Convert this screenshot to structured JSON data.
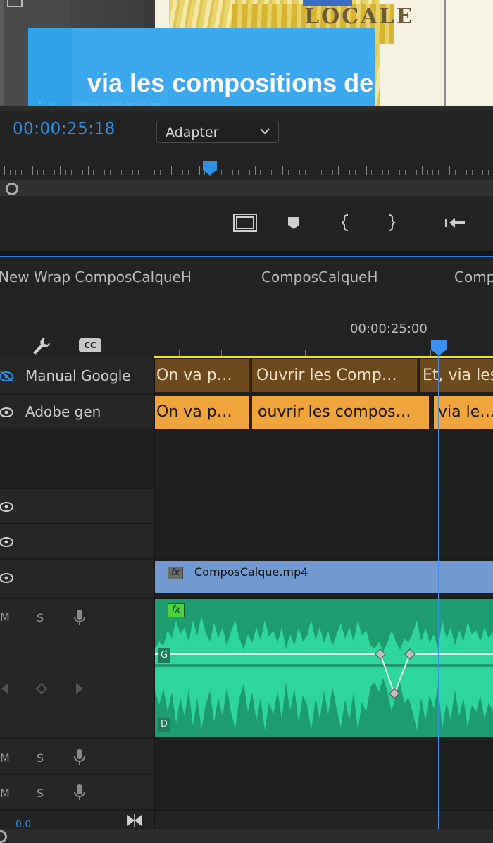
{
  "program_monitor": {
    "frame_text": "LOCALE",
    "caption_preview": "via les compositions de",
    "status_zoom": "50 %",
    "status_size": "2100 px × 2100 px (72 ppp)",
    "timecode": "00:00:25:18",
    "fit_select": "Adapter",
    "buttons": {
      "safe_margins": "safe-margins-icon",
      "add_marker": "marker-icon",
      "mark_in": "mark-in-icon",
      "mark_out": "mark-out-icon",
      "go_to_in": "go-to-in-icon"
    },
    "playhead_color": "#2f8fe0"
  },
  "timeline": {
    "sequence_tabs": [
      "New Wrap ComposCalqueH",
      "ComposCalqueH",
      "Compo"
    ],
    "timecode_label": "00:00:25:00",
    "header_icons": {
      "wrench": "wrench-icon",
      "captions": "CC"
    },
    "caption_tracks": [
      {
        "name": "Manual Google",
        "clips": [
          "On va p…",
          "Ouvrir les Comp…",
          "Et, via les"
        ]
      },
      {
        "name": "Adobe gen",
        "clips": [
          "On va p…",
          "ouvrir les compos…",
          "via le…"
        ]
      }
    ],
    "video_clip": {
      "fx": "fx",
      "name": "ComposCalque.mp4"
    },
    "audio_track": {
      "mute": "M",
      "solo": "S",
      "fx": "fx",
      "channel_left": "G",
      "channel_right": "D"
    },
    "audio_tracks_extra": [
      {
        "mute": "M",
        "solo": "S"
      },
      {
        "mute": "M",
        "solo": "S"
      }
    ],
    "bottom_indicator": "0.0",
    "colors": {
      "caption_dark": "#6c4a1d",
      "caption_light": "#f0a53c",
      "video_clip": "#739ad0",
      "audio_clip": "#21a87a",
      "playhead": "#3a8ff1",
      "work_area": "#f4e21a"
    }
  }
}
